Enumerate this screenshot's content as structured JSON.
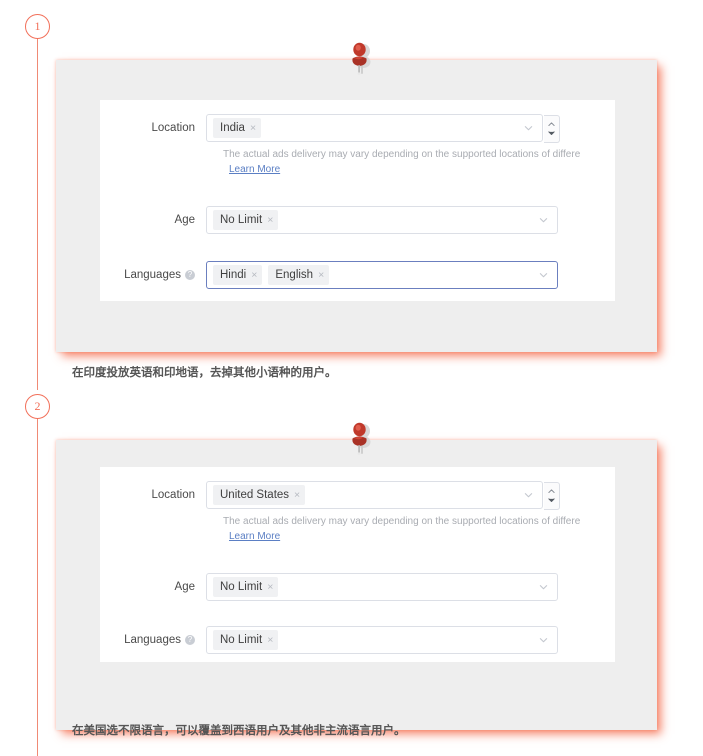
{
  "steps": [
    {
      "number": "1"
    },
    {
      "number": "2"
    }
  ],
  "icons": {
    "pushpin": "pushpin-icon",
    "chevron_down": "chevron-down-icon",
    "spinner_up": "spinner-up-arrow-icon",
    "spinner_down": "spinner-down-arrow-icon",
    "help": "help-circle-icon",
    "tag_close": "×"
  },
  "colors": {
    "accent": "#f2705a",
    "link": "#5b7fc4",
    "focus_border": "#6b7fbf",
    "card_bg": "#eeeeee",
    "tag_bg": "#f0f1f3"
  },
  "blocks": [
    {
      "caption": "在印度投放英语和印地语，去掉其他小语种的用户。",
      "form": {
        "location": {
          "label": "Location",
          "tags": [
            "India"
          ],
          "note": "The actual ads delivery may vary depending on the supported locations of differe",
          "learn_more": "Learn More"
        },
        "age": {
          "label": "Age",
          "tags": [
            "No Limit"
          ]
        },
        "languages": {
          "label": "Languages",
          "tags": [
            "Hindi",
            "English"
          ],
          "focused": true
        }
      }
    },
    {
      "caption": "在美国选不限语言，可以覆盖到西语用户及其他非主流语言用户。",
      "form": {
        "location": {
          "label": "Location",
          "tags": [
            "United States"
          ],
          "note": "The actual ads delivery may vary depending on the supported locations of differe",
          "learn_more": "Learn More"
        },
        "age": {
          "label": "Age",
          "tags": [
            "No Limit"
          ]
        },
        "languages": {
          "label": "Languages",
          "tags": [
            "No Limit"
          ],
          "focused": false
        }
      }
    }
  ]
}
